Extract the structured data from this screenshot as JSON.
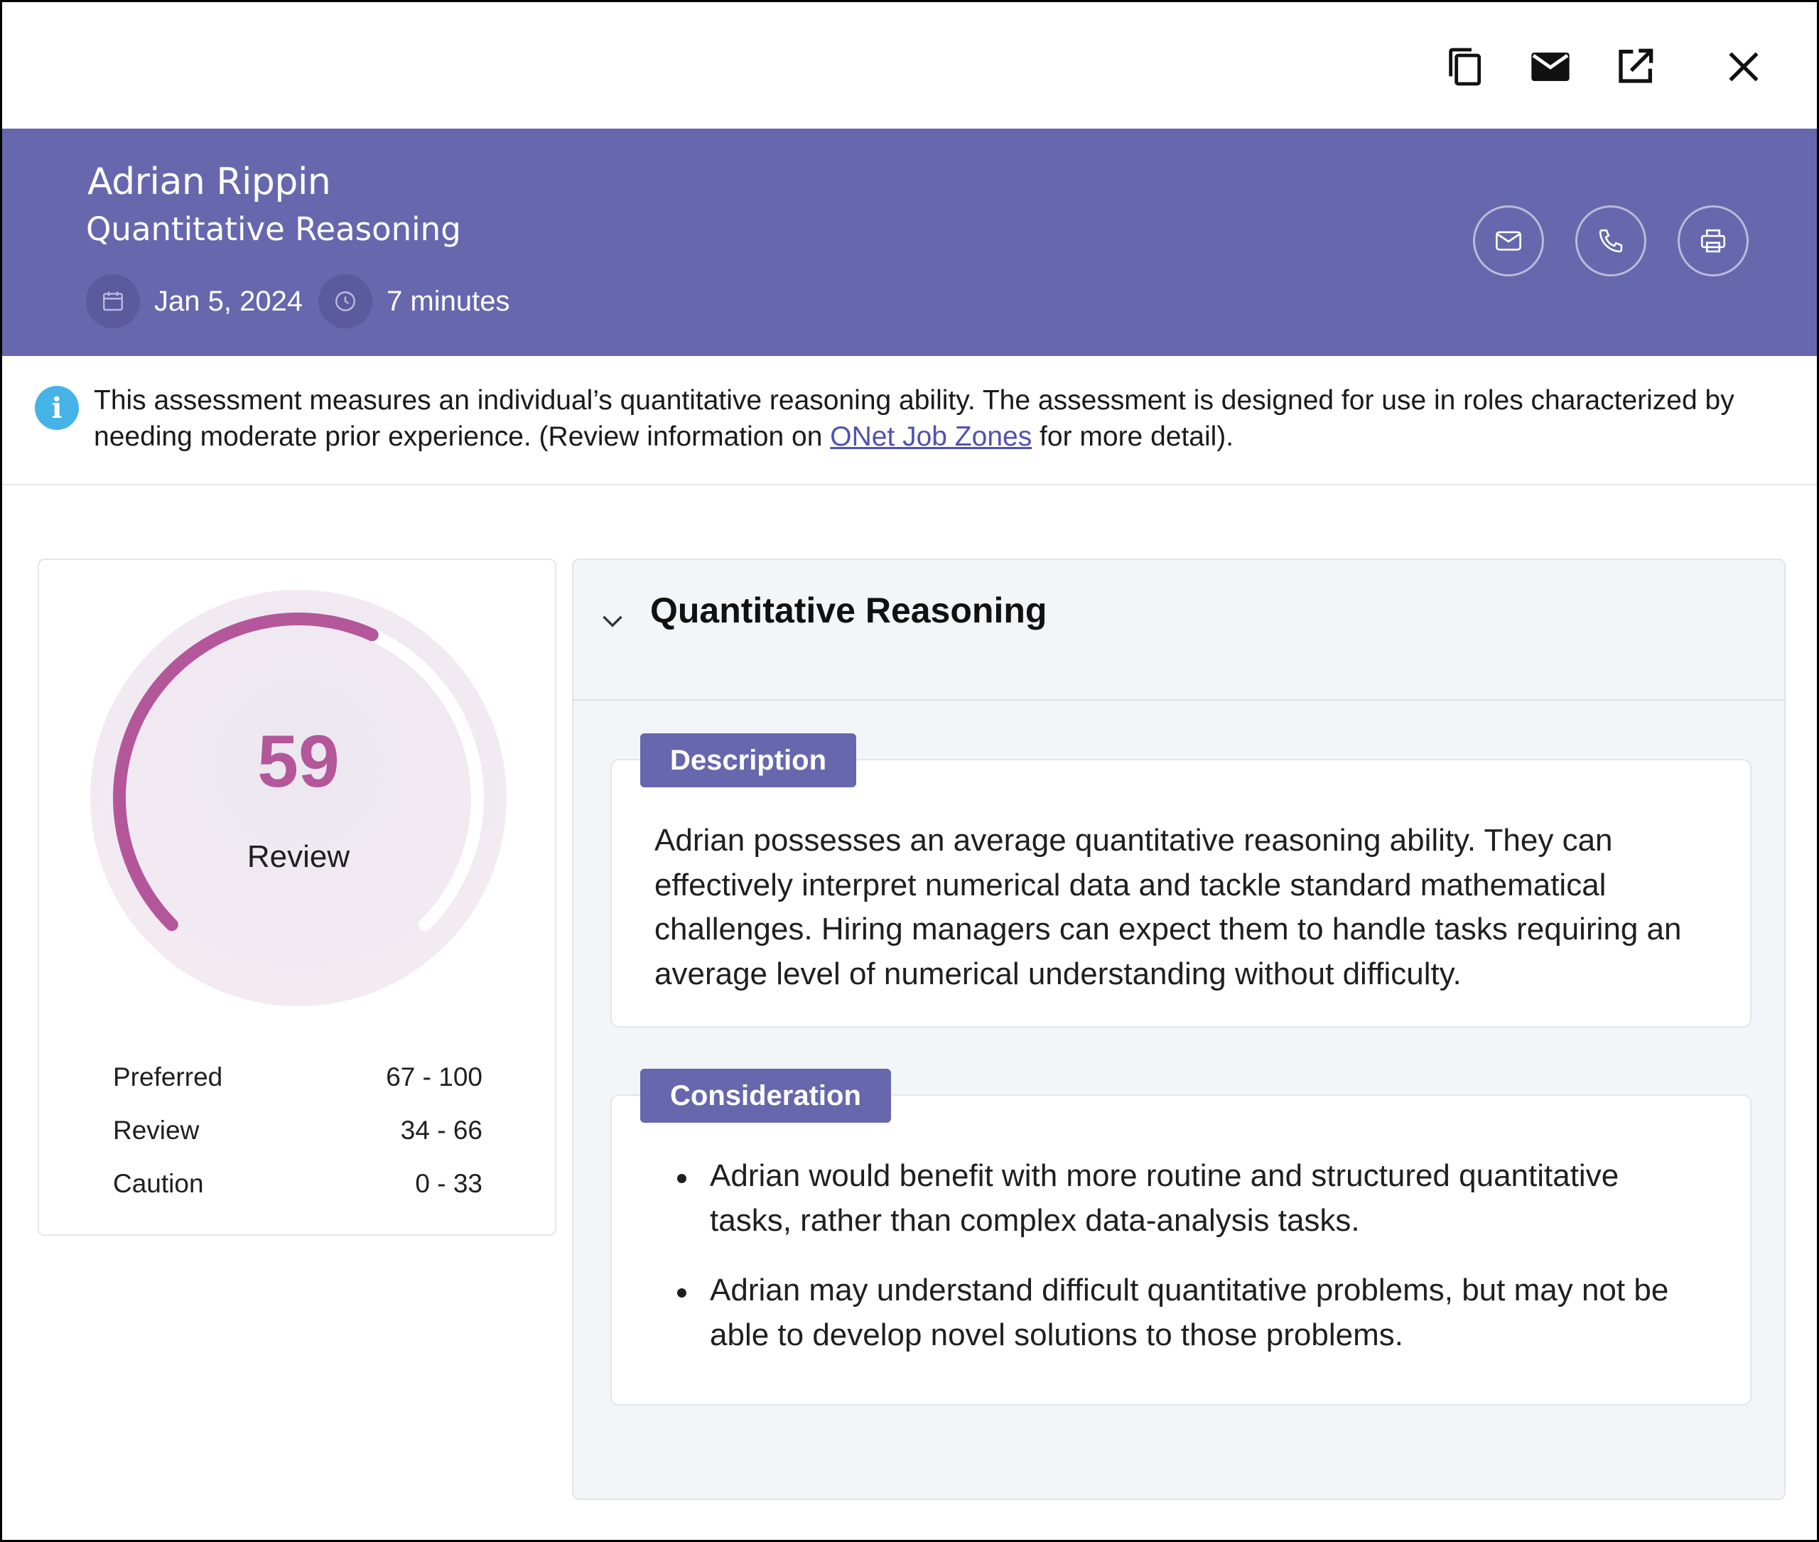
{
  "candidate": {
    "name": "Adrian Rippin",
    "assessment": "Quantitative Reasoning",
    "date": "Jan 5, 2024",
    "duration": "7 minutes"
  },
  "toolbar": {
    "icons": [
      "copy-icon",
      "mail-icon",
      "open-external-icon",
      "close-icon"
    ]
  },
  "header_actions": {
    "icons": [
      "envelope-icon",
      "phone-icon",
      "printer-icon"
    ]
  },
  "info": {
    "text_before": "This assessment measures an individual’s quantitative reasoning ability. The assessment is designed for use in roles characterized by needing moderate prior experience. (Review information on ",
    "link": "ONet Job Zones",
    "text_after": " for more detail)."
  },
  "score": {
    "value": "59",
    "band": "Review",
    "gauge_fill": 0.59,
    "ranges": [
      {
        "label": "Preferred",
        "range": "67 - 100"
      },
      {
        "label": "Review",
        "range": "34 - 66"
      },
      {
        "label": "Caution",
        "range": "0 - 33"
      }
    ]
  },
  "detail": {
    "title": "Quantitative Reasoning",
    "description_label": "Description",
    "description": "Adrian possesses an average quantitative reasoning ability. They can effectively interpret numerical data and tackle standard mathematical challenges. Hiring managers can expect them to handle tasks requiring an average level of numerical understanding without difficulty.",
    "consideration_label": "Consideration",
    "considerations": [
      "Adrian would benefit with more routine and structured quantitative tasks, rather than complex data-analysis tasks.",
      "Adrian may understand difficult quantitative problems, but may not be able to develop novel solutions to those problems."
    ]
  },
  "colors": {
    "header_bg": "#6767ae",
    "accent_magenta": "#b3579a",
    "info_blue": "#46b3e6",
    "panel_bg": "#f2f6f9"
  }
}
